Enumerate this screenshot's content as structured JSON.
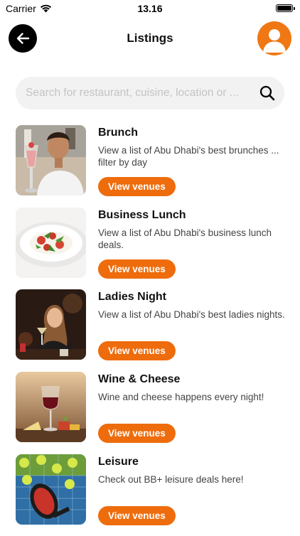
{
  "status": {
    "carrier": "Carrier",
    "time": "13.16"
  },
  "header": {
    "title": "Listings"
  },
  "search": {
    "placeholder": "Search for restaurant, cuisine, location or ..."
  },
  "colors": {
    "accent": "#ee6c0c",
    "avatar": "#f07814",
    "search_bg": "#f2f2f2"
  },
  "listings": [
    {
      "title": "Brunch",
      "description": "View a list of Abu Dhabi's best brunches ... filter by day",
      "button": "View venues"
    },
    {
      "title": "Business Lunch",
      "description": "View a list of Abu Dhabi's business lunch deals.",
      "button": "View venues"
    },
    {
      "title": "Ladies Night",
      "description": "View a list of Abu Dhabi's best ladies nights.",
      "button": "View venues"
    },
    {
      "title": "Wine & Cheese",
      "description": "Wine and cheese happens every night!",
      "button": "View venues"
    },
    {
      "title": "Leisure",
      "description": "Check out BB+ leisure deals here!",
      "button": "View venues"
    }
  ]
}
